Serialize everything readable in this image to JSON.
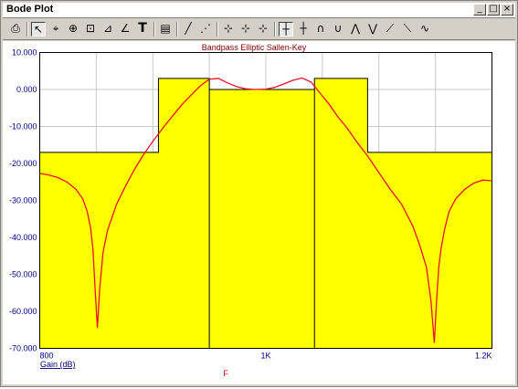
{
  "window": {
    "title": "Bode Plot"
  },
  "toolbar": {
    "icons": [
      "printer-icon",
      "select-arrow-icon",
      "cursor-tool-icon",
      "zoom-tool-icon",
      "pan-tool-icon",
      "marker-tool-icon",
      "annotate-tool-icon",
      "text-tool-icon",
      "properties-icon",
      "line-tool-icon",
      "dash-line-icon",
      "cursor-a-icon",
      "cursor-b-icon",
      "cursor-ab-icon",
      "horizontal-cursor-icon",
      "horizontal-cursor-2-icon",
      "bandpass-icon",
      "notch-icon",
      "peak-icon",
      "valley-icon",
      "slope-up-icon",
      "slope-down-icon",
      "ripple-icon"
    ]
  },
  "chart_data": {
    "type": "line",
    "title": "Bandpass Elliptic Sallen-Key",
    "xlabel": "F",
    "ylabel": "Gain (dB)",
    "xlim": [
      800,
      1200
    ],
    "ylim": [
      -70,
      10
    ],
    "xticks": [
      "800",
      "1K",
      "1.2K"
    ],
    "yticks": [
      "10.000",
      "0.000",
      "-10.000",
      "-20.000",
      "-30.000",
      "-40.000",
      "-50.000",
      "-60.000",
      "-70.000"
    ],
    "grid": true,
    "series": [
      {
        "type": "line",
        "color": "#e8102a",
        "x": [
          800,
          808,
          816,
          824,
          832,
          838,
          842,
          845,
          847,
          849,
          851,
          853,
          856,
          860,
          868,
          876,
          884,
          892,
          900,
          910,
          918,
          926,
          934,
          942,
          950,
          958,
          966,
          974,
          982,
          990,
          1000,
          1008,
          1016,
          1024,
          1032,
          1040,
          1048,
          1056,
          1064,
          1072,
          1080,
          1090,
          1100,
          1110,
          1120,
          1130,
          1136,
          1142,
          1146,
          1149,
          1151,
          1153,
          1155,
          1158,
          1162,
          1168,
          1176,
          1184,
          1192,
          1200
        ],
        "y": [
          -22.7,
          -23.1,
          -23.8,
          -25.0,
          -27.0,
          -29.5,
          -33.0,
          -37.5,
          -43.0,
          -54.0,
          -64.5,
          -54.0,
          -44.0,
          -38.0,
          -31.0,
          -26.0,
          -21.5,
          -17.5,
          -14.0,
          -10.0,
          -7.0,
          -4.0,
          -1.5,
          1.0,
          2.8,
          3.0,
          1.8,
          0.8,
          0.2,
          0.0,
          0.1,
          0.6,
          1.5,
          2.5,
          3.1,
          2.0,
          -1.0,
          -4.0,
          -7.5,
          -10.5,
          -14.0,
          -18.0,
          -22.5,
          -27.0,
          -31.0,
          -37.0,
          -42.0,
          -48.0,
          -57.0,
          -68.5,
          -57.0,
          -48.0,
          -43.0,
          -38.0,
          -33.0,
          -29.5,
          -27.0,
          -25.3,
          -24.5,
          -24.7
        ]
      },
      {
        "type": "mask",
        "fill": "#ffff00",
        "stroke": "#000000",
        "x": [
          800,
          905,
          905,
          950,
          950,
          1043,
          1043,
          1090,
          1090,
          1200
        ],
        "y": [
          -17,
          -17,
          3,
          3,
          0,
          0,
          3,
          3,
          -17,
          -17
        ]
      }
    ]
  }
}
